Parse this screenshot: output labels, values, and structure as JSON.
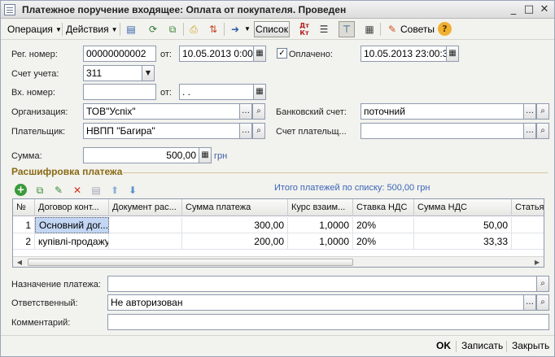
{
  "window": {
    "title": "Платежное поручение входящее: Оплата от покупателя. Проведен",
    "minimize_glyph": "_",
    "maximize_glyph": "□",
    "close_glyph": "✕"
  },
  "toolbar": {
    "operation_label": "Операция",
    "actions_label": "Действия",
    "list_label": "Список",
    "tips_label": "Советы",
    "help_glyph": "?"
  },
  "form": {
    "reg_number_label": "Рег. номер:",
    "reg_number_value": "00000000002",
    "from_label": "от:",
    "reg_date_value": "10.05.2013  0:00:",
    "paid_label": "Оплачено:",
    "paid_checked": true,
    "paid_date_value": "10.05.2013 23:00:31",
    "account_label": "Счет учета:",
    "account_value": "311",
    "in_number_label": "Вх. номер:",
    "in_number_value": "",
    "in_from_label": "от:",
    "in_date_value": "  .  .",
    "organization_label": "Организация:",
    "organization_value": "ТОВ\"Успіх\"",
    "bank_account_label": "Банковский счет:",
    "bank_account_value": "поточний",
    "payer_label": "Плательщик:",
    "payer_value": "НВПП \"Багира\"",
    "payer_account_label": "Счет плательщ...",
    "payer_account_value": "",
    "sum_label": "Сумма:",
    "sum_value": "500,00",
    "currency": "грн",
    "purpose_label": "Назначение платежа:",
    "purpose_value": "",
    "responsible_label": "Ответственный:",
    "responsible_value": "Не авторизован",
    "comment_label": "Комментарий:",
    "comment_value": ""
  },
  "section": {
    "title": "Расшифровка платежа",
    "total_text": "Итого платежей по списку: 500,00 грн"
  },
  "grid": {
    "headers": [
      "№",
      "Договор конт...",
      "Документ рас...",
      "Сумма платежа",
      "Курс взаим...",
      "Ставка НДС",
      "Сумма НДС",
      "Статья"
    ],
    "rows": [
      [
        "1",
        "Основний дог...",
        "",
        "300,00",
        "1,0000",
        "20%",
        "50,00",
        ""
      ],
      [
        "2",
        "купівлі-продажу",
        "",
        "200,00",
        "1,0000",
        "20%",
        "33,33",
        ""
      ]
    ]
  },
  "footer": {
    "ok_label": "OK",
    "save_label": "Записать",
    "close_label": "Закрыть"
  },
  "colors": {
    "section_title": "#8a6a12",
    "link": "#3a66b8",
    "selection": "#c3d7f4"
  }
}
